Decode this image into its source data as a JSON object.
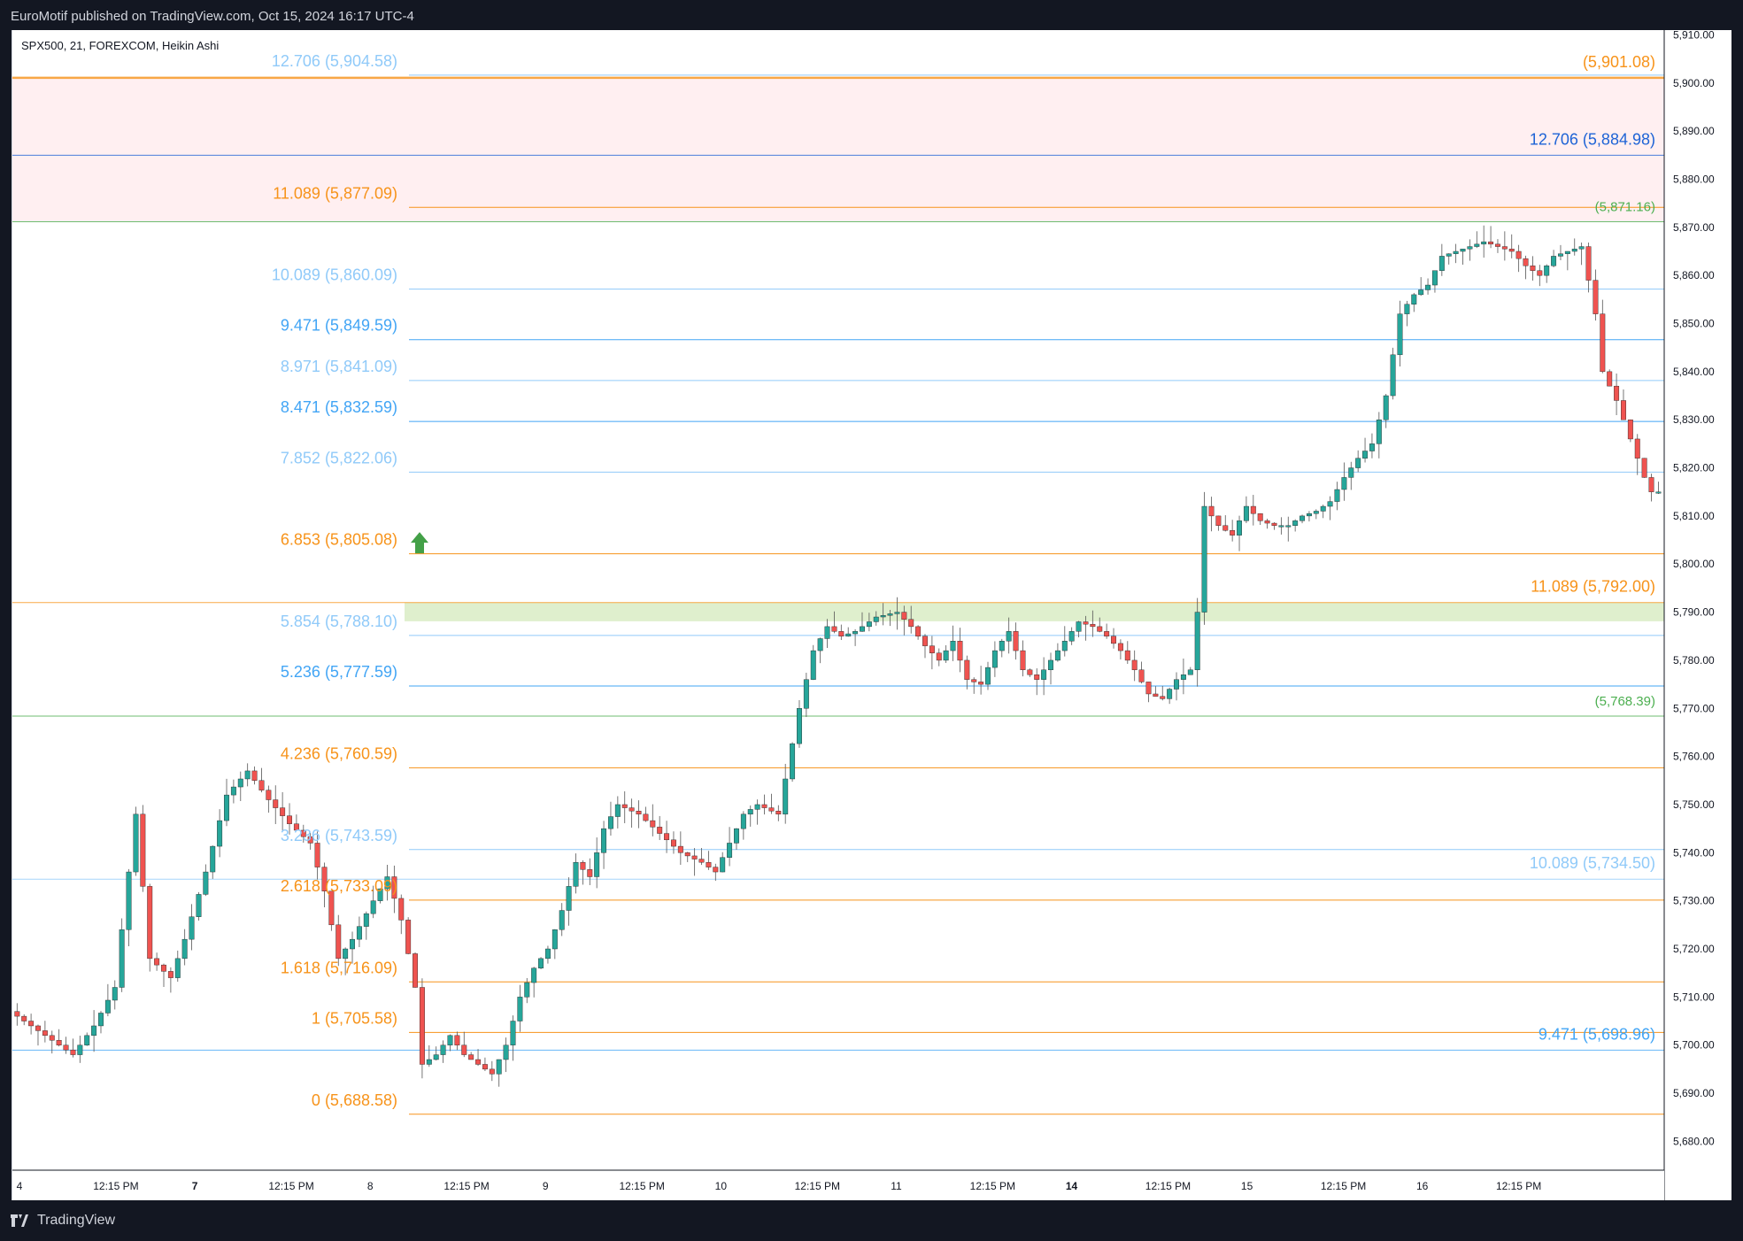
{
  "header": {
    "publish_text": "EuroMotif published on TradingView.com, Oct 15, 2024 16:17 UTC-4"
  },
  "chart_info": {
    "symbol_text": "SPX500, 21, FOREXCOM, Heikin Ashi"
  },
  "footer": {
    "brand": "TradingView"
  },
  "colors": {
    "up_candle": "#26a69a",
    "down_candle": "#ef5350",
    "orange": "#f7931a",
    "light_blue": "#90caf9",
    "blue": "#42a5f5",
    "dark_blue": "#1e63d6",
    "green_label": "#4caf50",
    "zone_red": "#ffebee",
    "zone_green": "#dcedc8",
    "path_red": "#f06272",
    "marker_green": "#43a047"
  },
  "chart_data": {
    "type": "candlestick",
    "title": "",
    "xlabel": "",
    "ylabel": "",
    "ylim": [
      5674,
      5911
    ],
    "y_ticks": [
      "5,680.00",
      "5,690.00",
      "5,700.00",
      "5,710.00",
      "5,720.00",
      "5,730.00",
      "5,740.00",
      "5,750.00",
      "5,760.00",
      "5,770.00",
      "5,780.00",
      "5,790.00",
      "5,800.00",
      "5,810.00",
      "5,820.00",
      "5,830.00",
      "5,840.00",
      "5,850.00",
      "5,860.00",
      "5,870.00",
      "5,880.00",
      "5,890.00",
      "5,900.00",
      "5,910.00"
    ],
    "x_ticks": [
      "4",
      "12:15 PM",
      "7",
      "12:15 PM",
      "8",
      "12:15 PM",
      "9",
      "12:15 PM",
      "10",
      "12:15 PM",
      "11",
      "12:15 PM",
      "14",
      "12:15 PM",
      "15",
      "12:15 PM",
      "16",
      "12:15 PM"
    ],
    "x_tick_bold": [
      false,
      false,
      true,
      false,
      false,
      false,
      false,
      false,
      false,
      false,
      false,
      false,
      true,
      false,
      false,
      false,
      false,
      false
    ],
    "price_path": [
      [
        0,
        5707
      ],
      [
        5,
        5702
      ],
      [
        9,
        5698
      ],
      [
        12,
        5704
      ],
      [
        15,
        5712
      ],
      [
        18,
        5748
      ],
      [
        20,
        5718
      ],
      [
        23,
        5714
      ],
      [
        25,
        5722
      ],
      [
        28,
        5736
      ],
      [
        31,
        5752
      ],
      [
        34,
        5757
      ],
      [
        37,
        5751
      ],
      [
        40,
        5746
      ],
      [
        43,
        5742
      ],
      [
        45,
        5732
      ],
      [
        47,
        5718
      ],
      [
        49,
        5722
      ],
      [
        52,
        5730
      ],
      [
        54,
        5735
      ],
      [
        56,
        5726
      ],
      [
        58,
        5712
      ],
      [
        59,
        5696
      ],
      [
        61,
        5698
      ],
      [
        63,
        5702
      ],
      [
        65,
        5698
      ],
      [
        67,
        5696
      ],
      [
        69,
        5694
      ],
      [
        71,
        5700
      ],
      [
        73,
        5710
      ],
      [
        75,
        5716
      ],
      [
        77,
        5720
      ],
      [
        79,
        5728
      ],
      [
        81,
        5738
      ],
      [
        83,
        5735
      ],
      [
        85,
        5745
      ],
      [
        87,
        5750
      ],
      [
        90,
        5748
      ],
      [
        93,
        5744
      ],
      [
        96,
        5740
      ],
      [
        99,
        5738
      ],
      [
        101,
        5736
      ],
      [
        103,
        5742
      ],
      [
        105,
        5748
      ],
      [
        107,
        5750
      ],
      [
        110,
        5748
      ],
      [
        113,
        5770
      ],
      [
        115,
        5782
      ],
      [
        117,
        5787
      ],
      [
        119,
        5785
      ],
      [
        121,
        5786
      ],
      [
        124,
        5789
      ],
      [
        127,
        5790
      ],
      [
        129,
        5787
      ],
      [
        131,
        5783
      ],
      [
        133,
        5780
      ],
      [
        135,
        5784
      ],
      [
        137,
        5776
      ],
      [
        139,
        5775
      ],
      [
        141,
        5782
      ],
      [
        143,
        5786
      ],
      [
        145,
        5778
      ],
      [
        147,
        5776
      ],
      [
        149,
        5780
      ],
      [
        151,
        5784
      ],
      [
        153,
        5788
      ],
      [
        155,
        5787
      ],
      [
        157,
        5785
      ],
      [
        159,
        5782
      ],
      [
        161,
        5778
      ],
      [
        163,
        5773
      ],
      [
        165,
        5772
      ],
      [
        167,
        5776
      ],
      [
        169,
        5778
      ],
      [
        170,
        5790
      ],
      [
        171,
        5812
      ],
      [
        173,
        5808
      ],
      [
        175,
        5806
      ],
      [
        177,
        5812
      ],
      [
        179,
        5809
      ],
      [
        181,
        5808
      ],
      [
        183,
        5808
      ],
      [
        185,
        5810
      ],
      [
        187,
        5811
      ],
      [
        189,
        5813
      ],
      [
        191,
        5818
      ],
      [
        193,
        5822
      ],
      [
        195,
        5825
      ],
      [
        197,
        5835
      ],
      [
        199,
        5852
      ],
      [
        201,
        5856
      ],
      [
        203,
        5858
      ],
      [
        205,
        5864
      ],
      [
        207,
        5865
      ],
      [
        209,
        5866
      ],
      [
        211,
        5867
      ],
      [
        213,
        5866
      ],
      [
        215,
        5865
      ],
      [
        217,
        5862
      ],
      [
        219,
        5860
      ],
      [
        221,
        5864
      ],
      [
        223,
        5865
      ],
      [
        225,
        5866
      ],
      [
        227,
        5852
      ],
      [
        228,
        5840
      ],
      [
        230,
        5834
      ],
      [
        232,
        5826
      ],
      [
        234,
        5818
      ],
      [
        235,
        5815
      ]
    ],
    "fib_left": [
      {
        "ratio": "12.706",
        "price": "(5,904.58)",
        "value": 5904.58,
        "color": "light_blue"
      },
      {
        "ratio": "11.089",
        "price": "(5,877.09)",
        "value": 5877.09,
        "color": "orange"
      },
      {
        "ratio": "10.089",
        "price": "(5,860.09)",
        "value": 5860.09,
        "color": "light_blue"
      },
      {
        "ratio": "9.471",
        "price": "(5,849.59)",
        "value": 5849.59,
        "color": "blue"
      },
      {
        "ratio": "8.971",
        "price": "(5,841.09)",
        "value": 5841.09,
        "color": "light_blue"
      },
      {
        "ratio": "8.471",
        "price": "(5,832.59)",
        "value": 5832.59,
        "color": "blue"
      },
      {
        "ratio": "7.852",
        "price": "(5,822.06)",
        "value": 5822.06,
        "color": "light_blue"
      },
      {
        "ratio": "6.853",
        "price": "(5,805.08)",
        "value": 5805.08,
        "color": "orange"
      },
      {
        "ratio": "5.854",
        "price": "(5,788.10)",
        "value": 5788.1,
        "color": "light_blue"
      },
      {
        "ratio": "5.236",
        "price": "(5,777.59)",
        "value": 5777.59,
        "color": "blue"
      },
      {
        "ratio": "4.236",
        "price": "(5,760.59)",
        "value": 5760.59,
        "color": "orange"
      },
      {
        "ratio": "3.236",
        "price": "(5,743.59)",
        "value": 5743.59,
        "color": "light_blue"
      },
      {
        "ratio": "2.618",
        "price": "(5,733.09)",
        "value": 5733.09,
        "color": "orange"
      },
      {
        "ratio": "1.618",
        "price": "(5,716.09)",
        "value": 5716.09,
        "color": "orange"
      },
      {
        "ratio": "1",
        "price": "(5,705.58)",
        "value": 5705.58,
        "color": "orange"
      },
      {
        "ratio": "0",
        "price": "(5,688.58)",
        "value": 5688.58,
        "color": "orange"
      }
    ],
    "fib_right": [
      {
        "text": "(5,901.08)",
        "value": 5901.08,
        "color": "orange",
        "bold": true
      },
      {
        "text": "12.706 (5,884.98)",
        "value": 5884.98,
        "color": "dark_blue"
      },
      {
        "text": "(5,871.16)",
        "value": 5871.16,
        "color": "green_label"
      },
      {
        "text": "11.089 (5,792.00)",
        "value": 5792.0,
        "color": "orange"
      },
      {
        "text": "(5,768.39)",
        "value": 5768.39,
        "color": "green_label"
      },
      {
        "text": "10.089 (5,734.50)",
        "value": 5734.5,
        "color": "light_blue"
      },
      {
        "text": "9.471 (5,698.96)",
        "value": 5698.96,
        "color": "blue"
      }
    ],
    "zones": [
      {
        "from": 5871.16,
        "to": 5901.08,
        "color": "zone_red"
      },
      {
        "from": 5788.1,
        "to": 5792.0,
        "color": "zone_green"
      }
    ]
  }
}
